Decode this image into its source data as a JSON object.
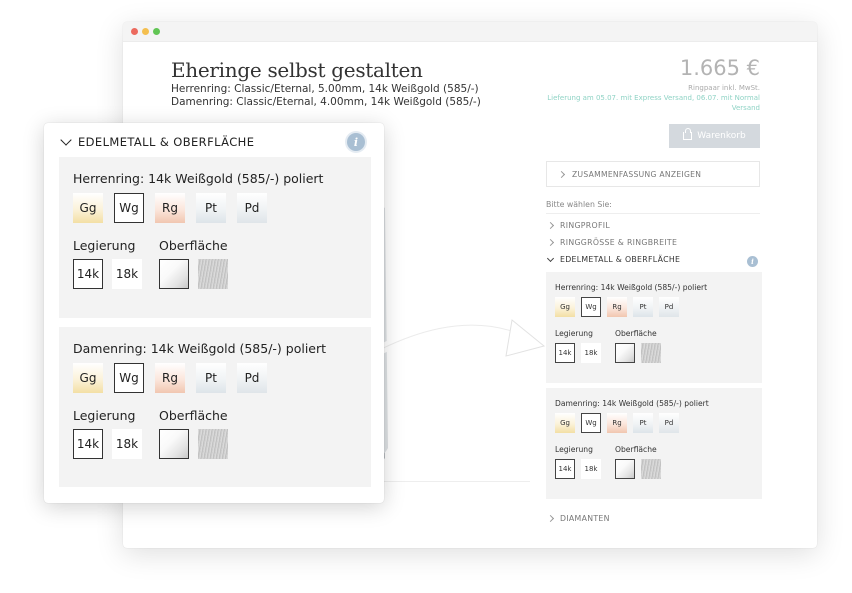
{
  "page": {
    "title": "Eheringe selbst gestalten",
    "spec_herren": "Herrenring:  Classic/Eternal, 5.00mm, 14k Weißgold (585/-)",
    "spec_damen": "Damenring:  Classic/Eternal, 4.00mm, 14k Weißgold (585/-)",
    "price": "1.665 €",
    "price_note": "Ringpaar inkl. MwSt.",
    "delivery": "Lieferung am 05.07. mit Express Versand, 06.07. mit Normal Versand",
    "cart_label": "Warenkorb",
    "summary_label": "ZUSAMMENFASSUNG ANZEIGEN",
    "choose_label": "Bitte wählen Sie:"
  },
  "accordion": {
    "ringprofil": "RINGPROFIL",
    "ringgroesse": "RINGGRÖSSE & RINGBREITE",
    "edelmetall": "EDELMETALL & OBERFLÄCHE",
    "diamanten": "DIAMANTEN"
  },
  "labels": {
    "legierung": "Legierung",
    "oberflaeche": "Oberfläche"
  },
  "metals": [
    "Gg",
    "Wg",
    "Rg",
    "Pt",
    "Pd"
  ],
  "alloys": [
    "14k",
    "18k"
  ],
  "herren": {
    "label": "Herrenring: 14k Weißgold (585/-) poliert",
    "metal": "Wg",
    "alloy": "14k",
    "surface": "poliert"
  },
  "damen": {
    "label": "Damenring: 14k Weißgold (585/-) poliert",
    "metal": "Wg",
    "alloy": "14k",
    "surface": "poliert"
  },
  "info_glyph": "i",
  "icons": {
    "cart": "shopping-bag-icon",
    "info": "info-icon",
    "chevron_right": "chevron-right-icon",
    "chevron_down": "chevron-down-icon"
  },
  "colors": {
    "accent_delivery": "#8fd3c5",
    "cart_button": "#d4d9de",
    "info_badge": "#a9bfd3",
    "panel_bg": "#f3f3f3",
    "gelbgold": "#f3dfa4",
    "rotgold": "#f1c6b0",
    "platin": "#dde4e9"
  }
}
